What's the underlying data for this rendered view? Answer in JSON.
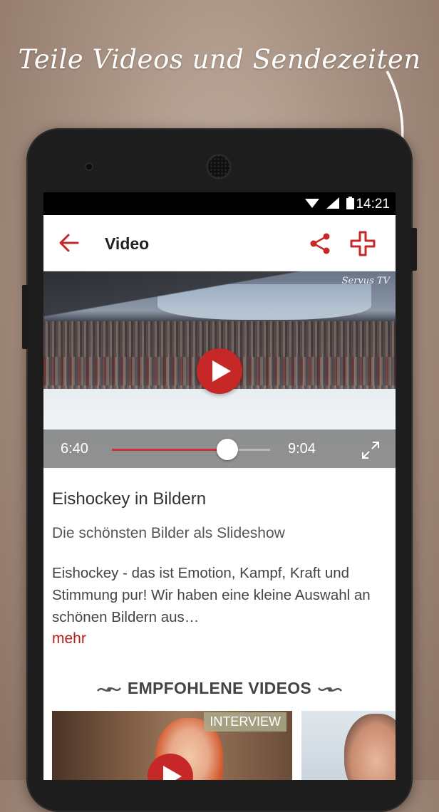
{
  "promo": {
    "caption": "Teile Videos und Sendezeiten"
  },
  "status_bar": {
    "time": "14:21"
  },
  "app_bar": {
    "title": "Video"
  },
  "video": {
    "current_time": "6:40",
    "duration": "9:04",
    "progress": 0.73,
    "channel_logo": "Servus TV"
  },
  "details": {
    "title": "Eishockey in Bildern",
    "subtitle": "Die schönsten Bilder als Slideshow",
    "description": "Eishockey - das ist Emotion, Kampf, Kraft und Stimmung pur! Wir haben eine kleine Auswahl an schönen Bildern aus…",
    "more_label": "mehr"
  },
  "recommended": {
    "heading": "EMPFOHLENE VIDEOS",
    "items": [
      {
        "badge": "INTERVIEW"
      },
      {
        "badge": ""
      }
    ]
  },
  "colors": {
    "accent": "#c62828"
  },
  "icons": [
    "back-arrow-icon",
    "share-icon",
    "add-icon",
    "play-icon",
    "fullscreen-icon",
    "wifi-icon",
    "signal-icon",
    "battery-icon"
  ]
}
